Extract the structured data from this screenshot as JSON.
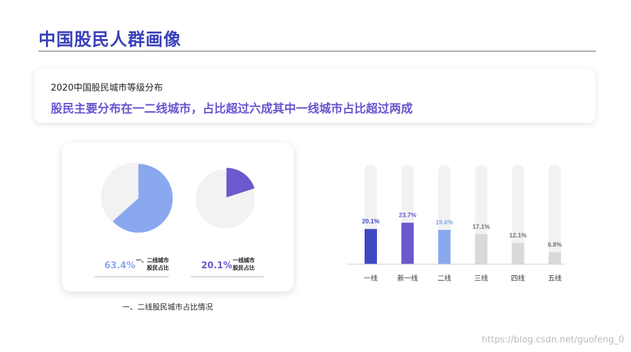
{
  "title": "中国股民人群画像",
  "card": {
    "subtitle": "2020中国股民城市等级分布",
    "headline": "股民主要分布在一二线城市，占比超过六成其中一线城市占比超过两成"
  },
  "pie_panel": {
    "caption": "一、二线股民城市占比情况",
    "pies": [
      {
        "value": 63.4,
        "value_text": "63.4%",
        "label_line1": "一、二线城市",
        "label_line2": "股民占比",
        "color": "#8aa8ee",
        "track": "#f2f2f2"
      },
      {
        "value": 20.1,
        "value_text": "20.1%",
        "label_line1": "一线城市",
        "label_line2": "股民占比",
        "color": "#6a5acd",
        "track": "#f2f2f2"
      }
    ]
  },
  "chart_data": {
    "type": "bar",
    "categories": [
      "一线",
      "新一线",
      "二线",
      "三线",
      "四线",
      "五线"
    ],
    "values": [
      20.1,
      23.7,
      19.6,
      17.1,
      12.1,
      6.8
    ],
    "value_labels": [
      "20.1%",
      "23.7%",
      "19.6%",
      "17.1%",
      "12.1%",
      "6.8%"
    ],
    "colors": [
      "#3f48c4",
      "#6a5acd",
      "#8aa8ee",
      "#d9d9d9",
      "#d9d9d9",
      "#d9d9d9"
    ],
    "label_colors": [
      "#3f48c4",
      "#6a5acd",
      "#8aa8ee",
      "#777777",
      "#777777",
      "#777777"
    ],
    "track_color": "#f2f2f2",
    "ylim": [
      0,
      60
    ]
  },
  "watermark": "https://blog.csdn.net/guofeng_0"
}
